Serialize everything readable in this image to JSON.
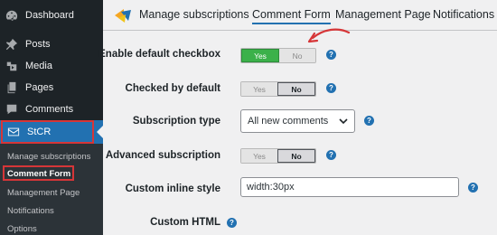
{
  "sidebar": {
    "items": [
      {
        "label": "Dashboard",
        "icon": "dashboard-icon"
      },
      {
        "label": "Posts",
        "icon": "pin-icon"
      },
      {
        "label": "Media",
        "icon": "media-icon"
      },
      {
        "label": "Pages",
        "icon": "pages-icon"
      },
      {
        "label": "Comments",
        "icon": "comments-icon"
      }
    ],
    "active": {
      "label": "StCR",
      "icon": "envelope-icon"
    },
    "submenu": [
      "Manage subscriptions",
      "Comment Form",
      "Management Page",
      "Notifications",
      "Options"
    ],
    "active_submenu": "Comment Form"
  },
  "tabs": [
    "Manage subscriptions",
    "Comment Form",
    "Management Page",
    "Notifications"
  ],
  "active_tab": "Comment Form",
  "form": {
    "enable_default_checkbox": {
      "label": "Enable default checkbox",
      "yes": "Yes",
      "no": "No",
      "selected": "Yes"
    },
    "checked_by_default": {
      "label": "Checked by default",
      "yes": "Yes",
      "no": "No",
      "selected": "No"
    },
    "subscription_type": {
      "label": "Subscription type",
      "value": "All new comments"
    },
    "advanced_subscription": {
      "label": "Advanced subscription",
      "yes": "Yes",
      "no": "No",
      "selected": "No"
    },
    "custom_inline_style": {
      "label": "Custom inline style",
      "value": "width:30px"
    },
    "custom_html": {
      "label": "Custom HTML"
    }
  },
  "help_glyph": "?",
  "colors": {
    "sidebar": "#1d2327",
    "active": "#2271b1",
    "highlight": "#d63638",
    "yes": "#3bb14a"
  }
}
